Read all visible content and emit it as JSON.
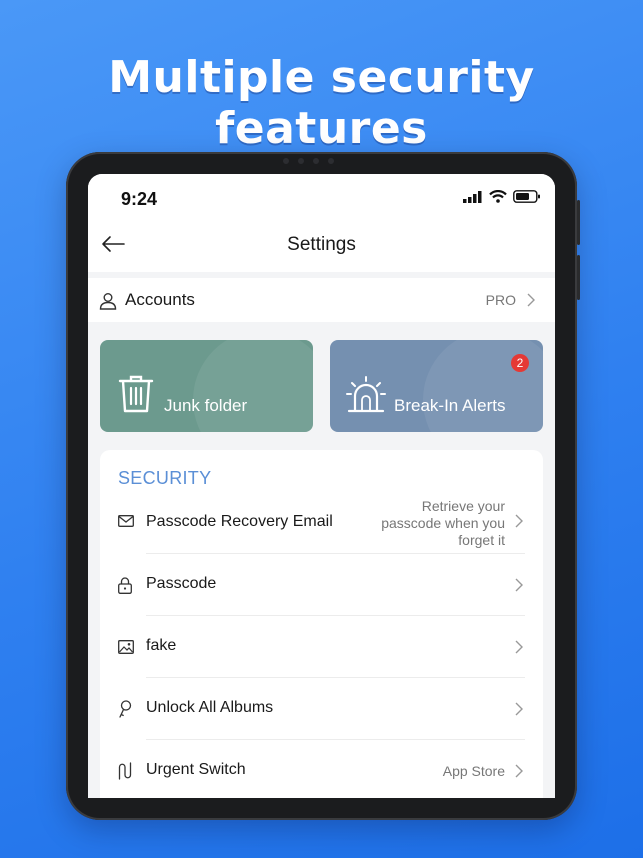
{
  "promo": {
    "headline": "Multiple security features"
  },
  "status_bar": {
    "time": "9:24"
  },
  "header": {
    "title": "Settings",
    "back_icon": "arrow-left-icon"
  },
  "accounts": {
    "label": "Accounts",
    "badge": "PRO"
  },
  "quick_cards": [
    {
      "label": "Junk folder",
      "icon": "trash-icon",
      "color": "#6c9a8e"
    },
    {
      "label": "Break-In Alerts",
      "icon": "alarm-light-icon",
      "color": "#7590b0",
      "badge": "2"
    }
  ],
  "security": {
    "heading": "SECURITY",
    "items": [
      {
        "label": "Passcode Recovery Email",
        "icon": "mail-icon",
        "value_lines": [
          "Retrieve your",
          "passcode when you",
          "forget it"
        ]
      },
      {
        "label": "Passcode",
        "icon": "lock-icon",
        "value": ""
      },
      {
        "label": "fake",
        "icon": "image-icon",
        "value": ""
      },
      {
        "label": "Unlock All Albums",
        "icon": "key-icon",
        "value": ""
      },
      {
        "label": "Urgent Switch",
        "icon": "switch-wave-icon",
        "value": "App Store"
      }
    ]
  },
  "colors": {
    "background": "#2f80f0",
    "accent": "#5b8fd6",
    "badge": "#e53935"
  }
}
